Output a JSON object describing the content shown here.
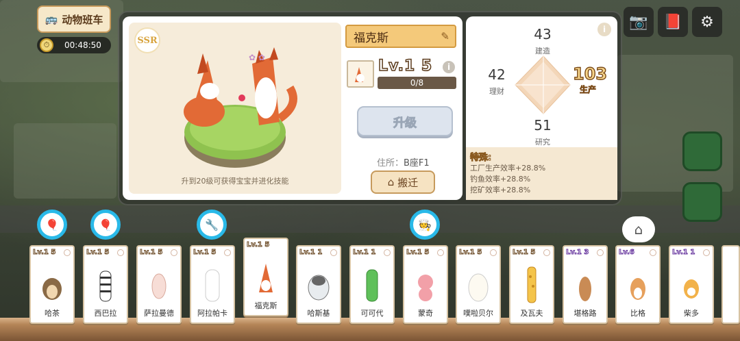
{
  "top_left": {
    "bus_label": "动物班车",
    "timer": "00:48:50"
  },
  "top_right": {
    "icons": [
      "camera-icon",
      "book-icon",
      "gear-icon"
    ]
  },
  "character": {
    "rarity": "SSR",
    "name": "福克斯",
    "level_text": "Lv.1 5",
    "exp": "0/8",
    "upgrade_label": "升级",
    "address_label": "住所：",
    "address_value": "B座F1",
    "move_label": "搬迁",
    "hint": "升到20级可获得宝宝并进化技能"
  },
  "stats": {
    "build_value": "43",
    "build_label": "建造",
    "finance_value": "42",
    "finance_label": "理财",
    "production_value": "103",
    "production_label": "生产",
    "research_value": "51",
    "research_label": "研究",
    "special_title": "特殊:",
    "special_lines": [
      "工厂生产效率+28.8%",
      "钓鱼效率+28.8%",
      "挖矿效率+28.8%"
    ]
  },
  "roster": [
    {
      "level": "Lv.1 5",
      "name": "哈茶"
    },
    {
      "level": "Lv.1 5",
      "name": "西巴拉"
    },
    {
      "level": "Lv.1 5",
      "name": "萨拉曼德"
    },
    {
      "level": "Lv.1 5",
      "name": "阿拉帕卡"
    },
    {
      "level": "Lv.1 5",
      "name": "福克斯"
    },
    {
      "level": "Lv.1 1",
      "name": "哈斯基"
    },
    {
      "level": "Lv.1 1",
      "name": "可可代"
    },
    {
      "level": "Lv.1 5",
      "name": "蒙奇"
    },
    {
      "level": "Lv.1 5",
      "name": "噗啦贝尔"
    },
    {
      "level": "Lv.1 5",
      "name": "及瓦夫"
    },
    {
      "level": "Lv.1 3",
      "name": "堪格路"
    },
    {
      "level": "Lv.6",
      "name": "比格"
    },
    {
      "level": "Lv.1 1",
      "name": "柴多"
    }
  ],
  "colors": {
    "accent": "#f4c97a",
    "bubble_ring": "#29b9e8",
    "exp_bar": "#6a5846"
  }
}
